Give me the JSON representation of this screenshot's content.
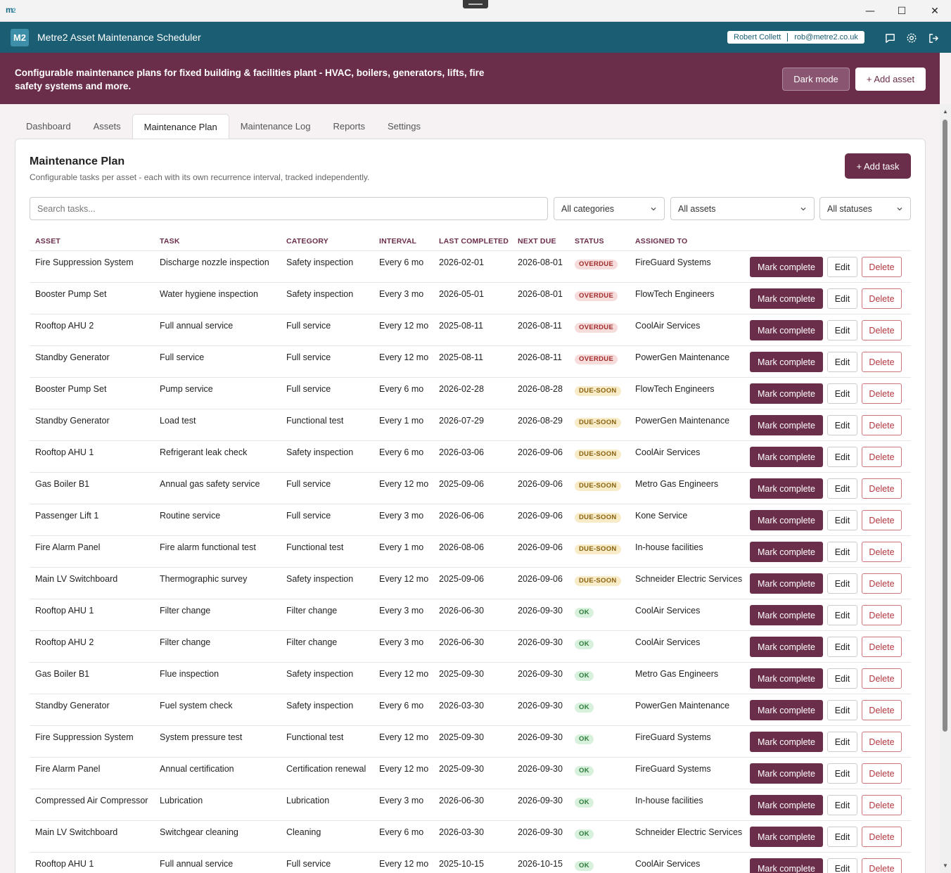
{
  "window": {
    "logo_text": "m",
    "logo_sub": "2",
    "controls": {
      "minimize": "—",
      "maximize": "☐",
      "close": "✕"
    }
  },
  "header": {
    "logo": "M2",
    "title": "Metre2 Asset Maintenance Scheduler",
    "user_name": "Robert Collett",
    "user_email": "rob@metre2.co.uk",
    "icons": [
      "chat-icon",
      "gear-icon",
      "logout-icon"
    ]
  },
  "banner": {
    "text": "Configurable maintenance plans for fixed building & facilities plant - HVAC, boilers, generators, lifts, fire safety systems and more.",
    "dark_mode_label": "Dark mode",
    "add_asset_label": "+ Add asset"
  },
  "tabs": [
    {
      "label": "Dashboard"
    },
    {
      "label": "Assets"
    },
    {
      "label": "Maintenance Plan"
    },
    {
      "label": "Maintenance Log"
    },
    {
      "label": "Reports"
    },
    {
      "label": "Settings"
    }
  ],
  "active_tab": "Maintenance Plan",
  "panel": {
    "title": "Maintenance Plan",
    "subtitle": "Configurable tasks per asset - each with its own recurrence interval, tracked independently.",
    "add_task_label": "+ Add task"
  },
  "filters": {
    "search_placeholder": "Search tasks...",
    "category": "All categories",
    "asset": "All assets",
    "status": "All statuses"
  },
  "table": {
    "headers": {
      "asset": "ASSET",
      "task": "TASK",
      "category": "CATEGORY",
      "interval": "INTERVAL",
      "last": "LAST COMPLETED",
      "next": "NEXT DUE",
      "status": "STATUS",
      "assigned": "ASSIGNED TO"
    },
    "action_labels": {
      "mark": "Mark complete",
      "edit": "Edit",
      "delete": "Delete"
    },
    "rows": [
      {
        "asset": "Fire Suppression System",
        "task": "Discharge nozzle inspection",
        "category": "Safety inspection",
        "interval": "Every 6 mo",
        "last": "2026-02-01",
        "next": "2026-08-01",
        "status": "OVERDUE",
        "assigned": "FireGuard Systems"
      },
      {
        "asset": "Booster Pump Set",
        "task": "Water hygiene inspection",
        "category": "Safety inspection",
        "interval": "Every 3 mo",
        "last": "2026-05-01",
        "next": "2026-08-01",
        "status": "OVERDUE",
        "assigned": "FlowTech Engineers"
      },
      {
        "asset": "Rooftop AHU 2",
        "task": "Full annual service",
        "category": "Full service",
        "interval": "Every 12 mo",
        "last": "2025-08-11",
        "next": "2026-08-11",
        "status": "OVERDUE",
        "assigned": "CoolAir Services"
      },
      {
        "asset": "Standby Generator",
        "task": "Full service",
        "category": "Full service",
        "interval": "Every 12 mo",
        "last": "2025-08-11",
        "next": "2026-08-11",
        "status": "OVERDUE",
        "assigned": "PowerGen Maintenance"
      },
      {
        "asset": "Booster Pump Set",
        "task": "Pump service",
        "category": "Full service",
        "interval": "Every 6 mo",
        "last": "2026-02-28",
        "next": "2026-08-28",
        "status": "DUE-SOON",
        "assigned": "FlowTech Engineers"
      },
      {
        "asset": "Standby Generator",
        "task": "Load test",
        "category": "Functional test",
        "interval": "Every 1 mo",
        "last": "2026-07-29",
        "next": "2026-08-29",
        "status": "DUE-SOON",
        "assigned": "PowerGen Maintenance"
      },
      {
        "asset": "Rooftop AHU 1",
        "task": "Refrigerant leak check",
        "category": "Safety inspection",
        "interval": "Every 6 mo",
        "last": "2026-03-06",
        "next": "2026-09-06",
        "status": "DUE-SOON",
        "assigned": "CoolAir Services"
      },
      {
        "asset": "Gas Boiler B1",
        "task": "Annual gas safety service",
        "category": "Full service",
        "interval": "Every 12 mo",
        "last": "2025-09-06",
        "next": "2026-09-06",
        "status": "DUE-SOON",
        "assigned": "Metro Gas Engineers"
      },
      {
        "asset": "Passenger Lift 1",
        "task": "Routine service",
        "category": "Full service",
        "interval": "Every 3 mo",
        "last": "2026-06-06",
        "next": "2026-09-06",
        "status": "DUE-SOON",
        "assigned": "Kone Service"
      },
      {
        "asset": "Fire Alarm Panel",
        "task": "Fire alarm functional test",
        "category": "Functional test",
        "interval": "Every 1 mo",
        "last": "2026-08-06",
        "next": "2026-09-06",
        "status": "DUE-SOON",
        "assigned": "In-house facilities"
      },
      {
        "asset": "Main LV Switchboard",
        "task": "Thermographic survey",
        "category": "Safety inspection",
        "interval": "Every 12 mo",
        "last": "2025-09-06",
        "next": "2026-09-06",
        "status": "DUE-SOON",
        "assigned": "Schneider Electric Services"
      },
      {
        "asset": "Rooftop AHU 1",
        "task": "Filter change",
        "category": "Filter change",
        "interval": "Every 3 mo",
        "last": "2026-06-30",
        "next": "2026-09-30",
        "status": "OK",
        "assigned": "CoolAir Services"
      },
      {
        "asset": "Rooftop AHU 2",
        "task": "Filter change",
        "category": "Filter change",
        "interval": "Every 3 mo",
        "last": "2026-06-30",
        "next": "2026-09-30",
        "status": "OK",
        "assigned": "CoolAir Services"
      },
      {
        "asset": "Gas Boiler B1",
        "task": "Flue inspection",
        "category": "Safety inspection",
        "interval": "Every 12 mo",
        "last": "2025-09-30",
        "next": "2026-09-30",
        "status": "OK",
        "assigned": "Metro Gas Engineers"
      },
      {
        "asset": "Standby Generator",
        "task": "Fuel system check",
        "category": "Safety inspection",
        "interval": "Every 6 mo",
        "last": "2026-03-30",
        "next": "2026-09-30",
        "status": "OK",
        "assigned": "PowerGen Maintenance"
      },
      {
        "asset": "Fire Suppression System",
        "task": "System pressure test",
        "category": "Functional test",
        "interval": "Every 12 mo",
        "last": "2025-09-30",
        "next": "2026-09-30",
        "status": "OK",
        "assigned": "FireGuard Systems"
      },
      {
        "asset": "Fire Alarm Panel",
        "task": "Annual certification",
        "category": "Certification renewal",
        "interval": "Every 12 mo",
        "last": "2025-09-30",
        "next": "2026-09-30",
        "status": "OK",
        "assigned": "FireGuard Systems"
      },
      {
        "asset": "Compressed Air Compressor",
        "task": "Lubrication",
        "category": "Lubrication",
        "interval": "Every 3 mo",
        "last": "2026-06-30",
        "next": "2026-09-30",
        "status": "OK",
        "assigned": "In-house facilities"
      },
      {
        "asset": "Main LV Switchboard",
        "task": "Switchgear cleaning",
        "category": "Cleaning",
        "interval": "Every 6 mo",
        "last": "2026-03-30",
        "next": "2026-09-30",
        "status": "OK",
        "assigned": "Schneider Electric Services"
      },
      {
        "asset": "Rooftop AHU 1",
        "task": "Full annual service",
        "category": "Full service",
        "interval": "Every 12 mo",
        "last": "2025-10-15",
        "next": "2026-10-15",
        "status": "OK",
        "assigned": "CoolAir Services"
      }
    ]
  },
  "colors": {
    "header_bg": "#1b5e73",
    "brand": "#6b2e4a",
    "overdue": "#a22c2c",
    "due_soon": "#8a6210",
    "ok": "#2c7a3a"
  }
}
